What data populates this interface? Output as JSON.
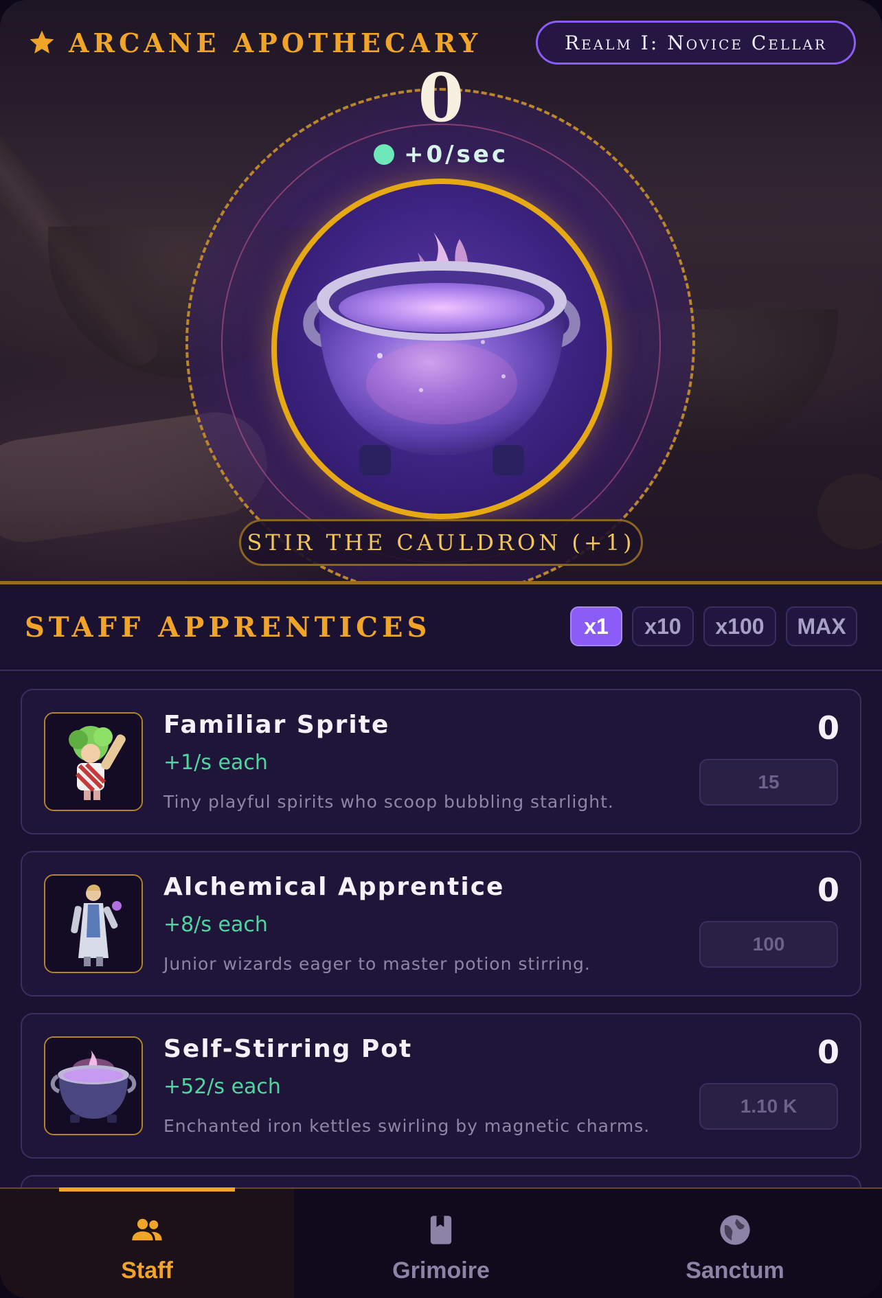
{
  "header": {
    "title": "ARCANE APOTHECARY",
    "realm": "Realm I: Novice Cellar"
  },
  "cauldron": {
    "essence": "0",
    "rate": "+0/sec",
    "stir_button": "STIR THE CAULDRON (+1)"
  },
  "staff": {
    "title": "STAFF APPRENTICES",
    "multipliers": [
      "x1",
      "x10",
      "x100",
      "MAX"
    ],
    "active_multiplier": "x1",
    "items": [
      {
        "name": "Familiar Sprite",
        "rate": "+1/s each",
        "description": "Tiny playful spirits who scoop bubbling starlight.",
        "owned": "0",
        "cost": "15",
        "icon": "sprite-portrait"
      },
      {
        "name": "Alchemical Apprentice",
        "rate": "+8/s each",
        "description": "Junior wizards eager to master potion stirring.",
        "owned": "0",
        "cost": "100",
        "icon": "apprentice-portrait"
      },
      {
        "name": "Self-Stirring Pot",
        "rate": "+52/s each",
        "description": "Enchanted iron kettles swirling by magnetic charms.",
        "owned": "0",
        "cost": "1.10 K",
        "icon": "pot-portrait"
      }
    ]
  },
  "nav": {
    "active": "Staff",
    "items": [
      {
        "label": "Staff",
        "icon": "people-icon"
      },
      {
        "label": "Grimoire",
        "icon": "book-icon"
      },
      {
        "label": "Sanctum",
        "icon": "globe-icon"
      }
    ]
  },
  "colors": {
    "accent_gold": "#f0a52a",
    "accent_purple": "#8b5cf6",
    "rate_green": "#4fd6a0",
    "background": "#1a1230"
  }
}
